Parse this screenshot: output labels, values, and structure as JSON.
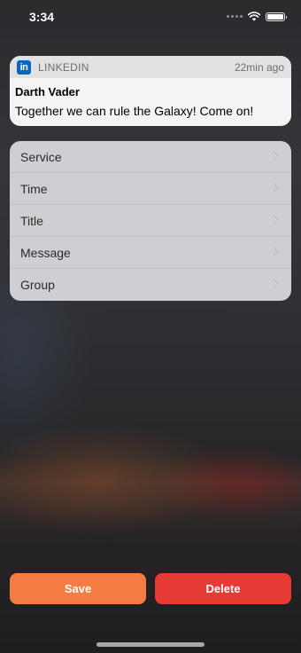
{
  "status_bar": {
    "time": "3:34",
    "icons": [
      "signal-dots-icon",
      "wifi-icon",
      "battery-icon"
    ]
  },
  "notification": {
    "app_icon": "linkedin-icon",
    "app_icon_text": "in",
    "app_name": "LINKEDIN",
    "time": "22min ago",
    "title": "Darth Vader",
    "message": "Together we can rule the Galaxy! Come on!",
    "colors": {
      "app_icon": "#0a66c2"
    }
  },
  "menu": {
    "items": [
      {
        "label": "Service"
      },
      {
        "label": "Time"
      },
      {
        "label": "Title"
      },
      {
        "label": "Message"
      },
      {
        "label": "Group"
      }
    ]
  },
  "actions": {
    "save_label": "Save",
    "delete_label": "Delete",
    "colors": {
      "save": "#f57c42",
      "delete": "#e63a35"
    }
  }
}
